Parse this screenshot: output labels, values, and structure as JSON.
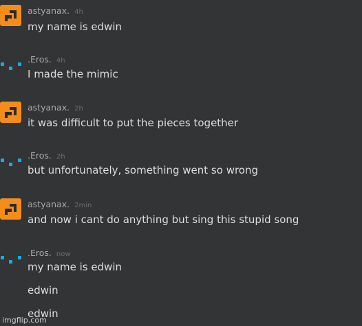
{
  "messages": [
    {
      "author": "astyanax.",
      "time": "4h",
      "avatar": "orange-block-icon",
      "lines": [
        "my name is edwin"
      ]
    },
    {
      "author": ".Eros.",
      "time": "4h",
      "avatar": "blue-dots-icon",
      "lines": [
        "I made the mimic"
      ]
    },
    {
      "author": "astyanax.",
      "time": "2h",
      "avatar": "orange-block-icon",
      "lines": [
        "it was difficult to put the pieces together"
      ]
    },
    {
      "author": ".Eros.",
      "time": "2h",
      "avatar": "blue-dots-icon",
      "lines": [
        "but unfortunately, something went so wrong"
      ]
    },
    {
      "author": "astyanax.",
      "time": "2min",
      "avatar": "orange-block-icon",
      "lines": [
        "and now i cant do anything but sing this stupid song"
      ]
    },
    {
      "author": ".Eros.",
      "time": "now",
      "avatar": "blue-dots-icon",
      "lines": [
        "my name is edwin",
        "edwin",
        "edwin"
      ]
    }
  ],
  "watermark": "imgflip.com",
  "colors": {
    "background": "#333436",
    "orange_avatar": "#f48d1a",
    "blue_dots": "#1aa9e6"
  }
}
